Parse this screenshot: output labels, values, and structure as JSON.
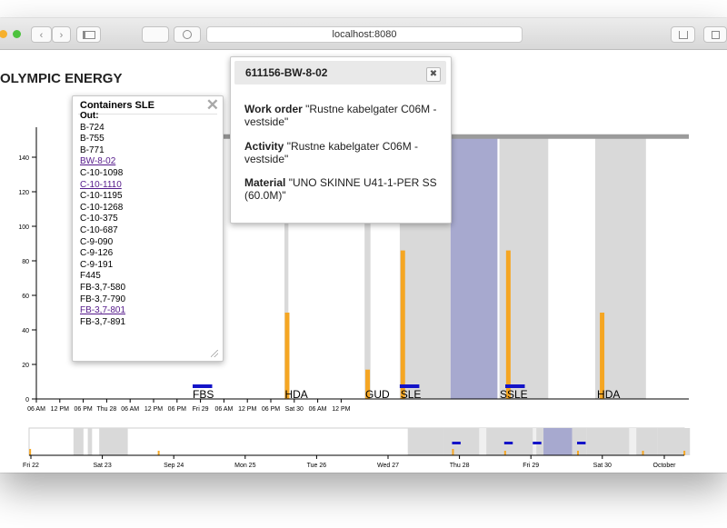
{
  "browser": {
    "url": "localhost:8080",
    "traffic_colors": [
      "#f6b02d",
      "#4cc23d"
    ]
  },
  "app": {
    "title": "OLYMPIC ENERGY"
  },
  "colors": {
    "accent_orange": "#f5a623",
    "accent_blue": "#1414c8",
    "band_gray": "#d9d9d9",
    "band_selected": "#a7a9cf",
    "capacity_line": "#9b9b9b"
  },
  "chart_data": [
    {
      "type": "bar",
      "name": "main-timeline",
      "x_ticks": [
        "06 AM",
        "12 PM",
        "06 PM",
        "Thu 28",
        "06 AM",
        "12 PM",
        "06 PM",
        "Fri 29",
        "06 AM",
        "12 PM",
        "06 PM",
        "Sat 30",
        "06 AM",
        "12 PM"
      ],
      "y_ticks": [
        "0",
        "20",
        "40",
        "60",
        "80",
        "100",
        "120",
        "140"
      ],
      "ylim": [
        0,
        150
      ],
      "capacity_line": 152,
      "bands": [
        {
          "start_h": 69.5,
          "end_h": 70.5,
          "selected": false
        },
        {
          "start_h": 90,
          "end_h": 91.5,
          "selected": false
        },
        {
          "start_h": 99,
          "end_h": 112,
          "selected": false
        },
        {
          "start_h": 112,
          "end_h": 124,
          "selected": true
        },
        {
          "start_h": 124.5,
          "end_h": 126,
          "selected": false
        },
        {
          "start_h": 126,
          "end_h": 137,
          "selected": false
        },
        {
          "start_h": 149,
          "end_h": 162,
          "selected": false
        }
      ],
      "bars": [
        {
          "hour": 69.6,
          "value": 50
        },
        {
          "hour": 90.2,
          "value": 17
        },
        {
          "hour": 99.2,
          "value": 86
        },
        {
          "hour": 126.2,
          "value": 86
        },
        {
          "hour": 150.2,
          "value": 50
        }
      ],
      "blue_marks": [
        {
          "start_h": 46,
          "end_h": 51
        },
        {
          "start_h": 99,
          "end_h": 104
        },
        {
          "start_h": 126,
          "end_h": 131
        }
      ],
      "locations": [
        {
          "label": "FBS",
          "hour": 46
        },
        {
          "label": "HDA",
          "hour": 69.6
        },
        {
          "label": "GUD",
          "hour": 90.2
        },
        {
          "label": "SLE",
          "hour": 99.2
        },
        {
          "label": "SSLE",
          "hour": 124.6
        },
        {
          "label": "HDA",
          "hour": 149.5
        }
      ]
    },
    {
      "type": "bar",
      "name": "overview-timeline",
      "x_ticks": [
        "Fri 22",
        "Sat 23",
        "Sep 24",
        "Mon 25",
        "Tue 26",
        "Wed 27",
        "Thu 28",
        "Fri 29",
        "Sat 30",
        "October"
      ]
    }
  ],
  "containers": {
    "title": "Containers SLE",
    "items": [
      {
        "text": "Out:",
        "bold": true,
        "link": false
      },
      {
        "text": "B-724",
        "bold": false,
        "link": false
      },
      {
        "text": "B-755",
        "bold": false,
        "link": false
      },
      {
        "text": "B-771",
        "bold": false,
        "link": false
      },
      {
        "text": "BW-8-02",
        "bold": false,
        "link": true
      },
      {
        "text": "C-10-1098",
        "bold": false,
        "link": false
      },
      {
        "text": "C-10-1110",
        "bold": false,
        "link": true
      },
      {
        "text": "C-10-1195",
        "bold": false,
        "link": false
      },
      {
        "text": "C-10-1268",
        "bold": false,
        "link": false
      },
      {
        "text": "C-10-375",
        "bold": false,
        "link": false
      },
      {
        "text": "C-10-687",
        "bold": false,
        "link": false
      },
      {
        "text": "C-9-090",
        "bold": false,
        "link": false
      },
      {
        "text": "C-9-126",
        "bold": false,
        "link": false
      },
      {
        "text": "C-9-191",
        "bold": false,
        "link": false
      },
      {
        "text": "F445",
        "bold": false,
        "link": false
      },
      {
        "text": "FB-3,7-580",
        "bold": false,
        "link": false
      },
      {
        "text": "FB-3,7-790",
        "bold": false,
        "link": false
      },
      {
        "text": "FB-3,7-801",
        "bold": false,
        "link": true
      },
      {
        "text": "FB-3,7-891",
        "bold": false,
        "link": false
      }
    ]
  },
  "workorder": {
    "title": "611156-BW-8-02",
    "fields": [
      {
        "label": "Work order",
        "value": "\"Rustne kabelgater C06M - vestside\""
      },
      {
        "label": "Activity",
        "value": "\"Rustne kabelgater C06M - vestside\""
      },
      {
        "label": "Material",
        "value": "\"UNO SKINNE U41-1-PER SS (60.0M)\""
      }
    ]
  }
}
